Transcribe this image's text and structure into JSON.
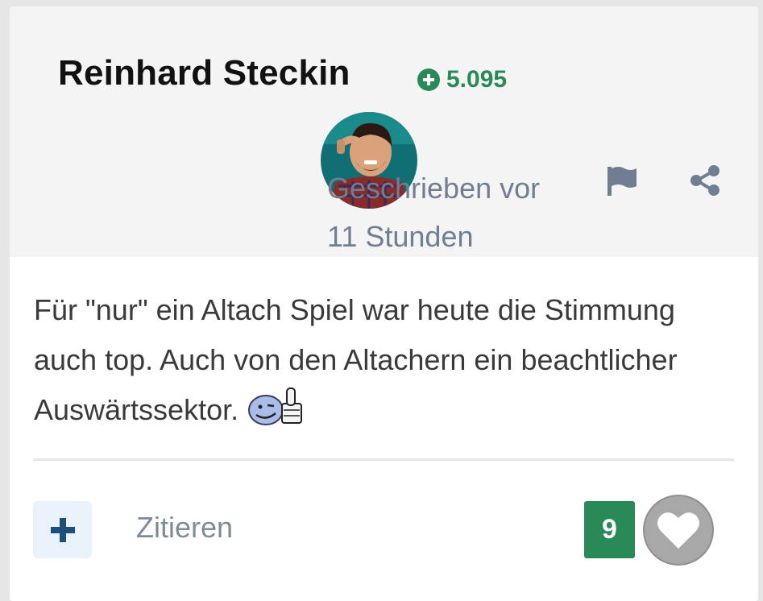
{
  "post": {
    "author_name": "Reinhard Steckin",
    "reputation": "5.095",
    "time_line1": "Geschrieben vor",
    "time_line2": "11 Stunden",
    "body_text": "Für \"nur\" ein Altach Spiel war heute die Stimmung auch top. Auch von den Altachern ein beachtlicher Auswärtssektor.",
    "icons": [
      "plus-circle-icon",
      "flag-icon",
      "share-icon",
      "thumbs-up-emoticon",
      "plus-icon",
      "heart-icon"
    ]
  },
  "footer": {
    "quote_label": "Zitieren",
    "like_count": "9"
  },
  "colors": {
    "accent_green": "#2a8a57",
    "meta_gray": "#6f7f91",
    "header_bg": "#f4f4f4",
    "like_button_gray": "#a8a8a8"
  }
}
